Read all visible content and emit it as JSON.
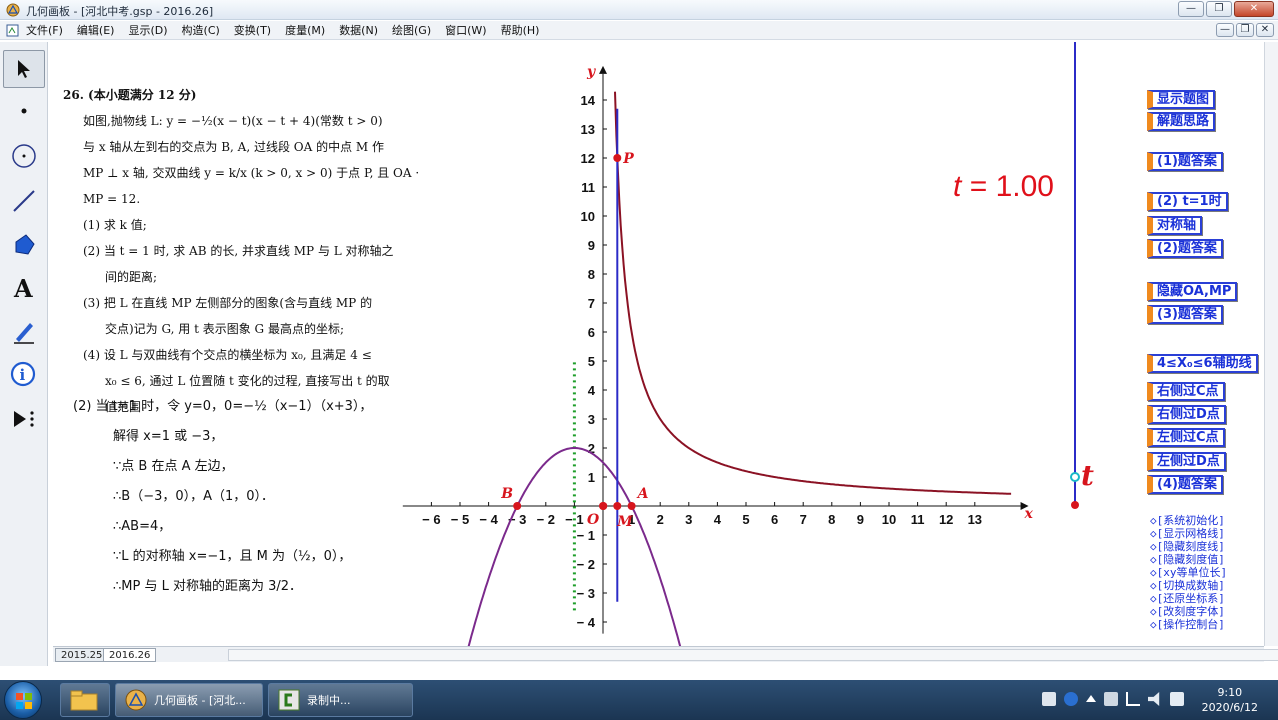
{
  "window": {
    "title": "几何画板 - [河北中考.gsp - 2016.26]",
    "controls": [
      "—",
      "❐",
      "✕"
    ],
    "inner_controls": [
      "—",
      "❐",
      "✕"
    ]
  },
  "menu": [
    "文件(F)",
    "编辑(E)",
    "显示(D)",
    "构造(C)",
    "变换(T)",
    "度量(M)",
    "数据(N)",
    "绘图(G)",
    "窗口(W)",
    "帮助(H)"
  ],
  "problem": {
    "lines": [
      "26. (本小题满分 12 分)",
      "如图,抛物线 L: y = −½(x − t)(x − t + 4)(常数 t > 0)",
      "与 x 轴从左到右的交点为 B, A, 过线段 OA 的中点 M 作",
      "MP ⊥ x 轴, 交双曲线 y = k/x (k > 0, x > 0) 于点 P, 且 OA ·",
      "MP = 12.",
      "(1) 求 k 值;",
      "(2) 当 t = 1 时, 求 AB 的长, 并求直线 MP 与 L 对称轴之",
      "间的距离;",
      "(3) 把 L 在直线 MP 左侧部分的图象(含与直线 MP 的",
      "交点)记为 G, 用 t 表示图象 G 最高点的坐标;",
      "(4) 设 L 与双曲线有个交点的横坐标为 x₀, 且满足 4 ≤",
      "x₀ ≤ 6, 通过 L 位置随 t 变化的过程, 直接写出 t 的取",
      "值范围."
    ]
  },
  "solution": {
    "lines": [
      "(2)    当 t=1 时，令 y=0，0=−½（x−1）（x+3），",
      "解得 x=1 或 −3，",
      "∵点 B 在点 A 左边，",
      "∴B（−3，0），A（1，0）．",
      "∴AB=4，",
      "∵L 的对称轴 x=−1，且 M 为（½，0），",
      "∴MP 与 L 对称轴的距离为 3/2．"
    ]
  },
  "parameter": {
    "name": "t",
    "readout_value": "1.00",
    "eq": "="
  },
  "graph": {
    "x_label": "x",
    "y_label": "y",
    "origin_label": "O",
    "x_ticks": [
      "-6",
      "-5",
      "-4",
      "-3",
      "-2",
      "-1",
      "1",
      "2",
      "3",
      "4",
      "5",
      "6",
      "7",
      "8",
      "9",
      "10",
      "11",
      "12",
      "13"
    ],
    "y_ticks": [
      "-4",
      "-3",
      "-2",
      "-1",
      "1",
      "2",
      "3",
      "4",
      "5",
      "6",
      "7",
      "8",
      "9",
      "10",
      "11",
      "12",
      "13",
      "14"
    ],
    "points": {
      "B": "B",
      "A": "A",
      "M": "M",
      "P": "P"
    },
    "slider_label": "t"
  },
  "buttons": [
    "显示题图",
    "解题思路",
    "(1)题答案",
    "(2) t=1时",
    "对称轴",
    "(2)题答案",
    "隐藏OA,MP",
    "(3)题答案",
    "4≤X₀≤6辅助线",
    "右侧过C点",
    "右侧过D点",
    "左侧过C点",
    "左侧过D点",
    "(4)题答案"
  ],
  "options": [
    "◇[系统初始化]",
    "◇[显示网格线]",
    "◇[隐藏刻度线]",
    "◇[隐藏刻度值]",
    "◇[xy等单位长]",
    "◇[切换成数轴]",
    "◇[还原坐标系]",
    "◇[改刻度字体]",
    "◇[操作控制台]"
  ],
  "tabs": [
    "2015.25",
    "2016.26"
  ],
  "taskbar": {
    "tasks": [
      "几何画板 - [河北...",
      "录制中..."
    ],
    "time": "9:10",
    "date": "2020/6/12"
  },
  "colors": {
    "accent_blue": "#1a31d8",
    "curve": "#8b1224",
    "parabola": "#7b2a8c",
    "line_mp": "#2b2bc7",
    "axis_dotted": "#1f9e2a",
    "point": "#d7151d"
  }
}
